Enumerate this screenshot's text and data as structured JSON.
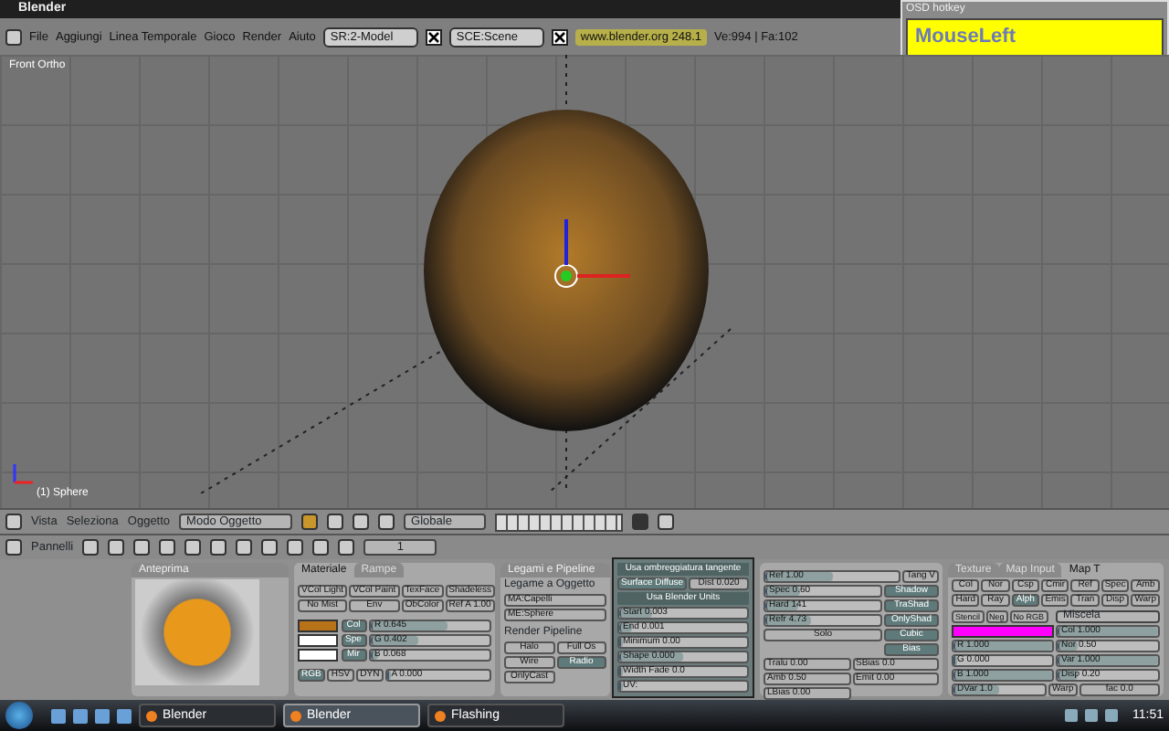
{
  "window": {
    "title": "Blender"
  },
  "menu": [
    "File",
    "Aggiungi",
    "Linea Temporale",
    "Gioco",
    "Render",
    "Aiuto"
  ],
  "screen_field": {
    "value": "SR:2-Model"
  },
  "scene_field": {
    "value": "SCE:Scene"
  },
  "version_link": "www.blender.org 248.1",
  "stats": "Ve:994 | Fa:102",
  "osd": {
    "title": "OSD hotkey",
    "text": "MouseLeft"
  },
  "viewport": {
    "view_label": "Front Ortho",
    "object_label": "(1) Sphere"
  },
  "view3d_header": {
    "menus": [
      "Vista",
      "Seleziona",
      "Oggetto"
    ],
    "mode": "Modo Oggetto",
    "orientation": "Globale"
  },
  "buttons_header": {
    "label": "Pannelli",
    "frame": "1"
  },
  "preview_panel": {
    "title": "Anteprima"
  },
  "material_panel": {
    "tabs": [
      {
        "label": "Materiale",
        "selected": true
      },
      {
        "label": "Rampe",
        "selected": false
      }
    ],
    "buttons": [
      {
        "label": "VCol Light",
        "on": false
      },
      {
        "label": "VCol Paint",
        "on": false
      },
      {
        "label": "TexFace",
        "on": false
      },
      {
        "label": "Shadeless",
        "on": false
      },
      {
        "label": "No Mist",
        "on": false
      },
      {
        "label": "Env",
        "on": false
      },
      {
        "label": "ObColor",
        "on": false
      },
      {
        "label": "Ref A 1.00",
        "on": false
      }
    ],
    "colors": [
      {
        "label": "Col",
        "color": "#b8731a",
        "reading": "R 0.645",
        "level": 0.645
      },
      {
        "label": "Spe",
        "color": "#ffffff",
        "reading": "G 0.402",
        "level": 0.402
      },
      {
        "label": "Mir",
        "color": "#ffffff",
        "reading": "B 0.068",
        "level": 0.068
      }
    ],
    "modes": [
      {
        "label": "RGB",
        "selected": true
      },
      {
        "label": "HSV",
        "selected": false
      },
      {
        "label": "DYN",
        "selected": false
      }
    ],
    "alpha": {
      "reading": "A 0.000",
      "level": 0.0
    }
  },
  "links_panel": {
    "title": "Legami e Pipeline",
    "link_label": "Legame a Oggetto",
    "material": "MA:Capelli",
    "mesh": "ME:Sphere",
    "pipeline_label": "Render Pipeline",
    "buttons": [
      {
        "label": "Halo",
        "on": false
      },
      {
        "label": "Full Os",
        "on": false
      },
      {
        "label": "Wire",
        "on": false
      },
      {
        "label": "Radio",
        "on": true
      },
      {
        "label": "OnlyCast",
        "on": false
      }
    ]
  },
  "shaders_panel": {
    "ref": {
      "label": "Ref 1.00",
      "level": 0.5
    },
    "tangent": "Tang V",
    "sliders": [
      {
        "label": "Spec 0.60",
        "level": 0.3
      },
      {
        "label": "Hard 141",
        "level": 0.28
      },
      {
        "label": "Refr 4.73",
        "level": 0.4
      }
    ],
    "toggles": [
      {
        "label": "Shadow",
        "on": true
      },
      {
        "label": "TraShad",
        "on": true
      },
      {
        "label": "OnlyShad",
        "on": true
      },
      {
        "label": "Cubic",
        "on": true
      },
      {
        "label": "Bias",
        "on": true
      }
    ],
    "solo": "Solo",
    "values": [
      "Tralu 0.00",
      "SBias 0.0",
      "Amb 0.50",
      "Emit 0.00",
      "LBias 0.00"
    ]
  },
  "popup": {
    "rows": [
      {
        "kind": "header",
        "label": "Usa ombreggiatura tangente"
      },
      {
        "kind": "pair",
        "label": "Surface Diffuse",
        "value": "Dist 0.020"
      },
      {
        "kind": "header",
        "label": "Usa Blender Units"
      },
      {
        "kind": "slider",
        "label": "Start 0.003",
        "level": 0.25
      },
      {
        "kind": "slider",
        "label": "End 0.001",
        "level": 0.1
      },
      {
        "kind": "slider",
        "label": "Minimum 0.00",
        "level": 0.0
      },
      {
        "kind": "slider",
        "label": "Shape 0.000",
        "level": 0.5
      },
      {
        "kind": "slider",
        "label": "Width Fade 0.0",
        "level": 0.0
      },
      {
        "kind": "slider",
        "label": "UV:",
        "level": 0.0
      }
    ]
  },
  "texture_panel": {
    "tabs": [
      {
        "label": "Texture",
        "selected": false
      },
      {
        "label": "Map Input",
        "selected": false
      },
      {
        "label": "Map T",
        "selected": true
      }
    ],
    "channels": [
      {
        "label": "Col",
        "on": false
      },
      {
        "label": "Nor",
        "on": false
      },
      {
        "label": "Csp",
        "on": false
      },
      {
        "label": "Cmir",
        "on": false
      },
      {
        "label": "Ref",
        "on": false
      },
      {
        "label": "Spec",
        "on": false
      },
      {
        "label": "Amb",
        "on": false
      },
      {
        "label": "Hard",
        "on": false
      },
      {
        "label": "Ray",
        "on": false
      },
      {
        "label": "Alph",
        "on": true
      },
      {
        "label": "Emis",
        "on": false
      },
      {
        "label": "Tran",
        "on": false
      },
      {
        "label": "Disp",
        "on": false
      },
      {
        "label": "Warp",
        "on": false
      }
    ],
    "flags": [
      "Stencil",
      "Neg",
      "No RGB"
    ],
    "blend": "Miscela",
    "swatch": {
      "color": "#ff00ff"
    },
    "rgb": [
      {
        "label": "R 1.000",
        "level": 1.0
      },
      {
        "label": "G 0.000",
        "level": 0.0
      },
      {
        "label": "B 1.000",
        "level": 1.0
      }
    ],
    "factors": [
      {
        "label": "Col 1.000",
        "level": 1.0
      },
      {
        "label": "Nor 0.50",
        "level": 0.2
      },
      {
        "label": "Var 1.000",
        "level": 1.0
      },
      {
        "label": "Disp 0.20",
        "level": 0.2
      }
    ],
    "dvar": {
      "label": "DVar 1.0",
      "level": 0.5
    },
    "warp": "Warp",
    "fac": "fac 0.0"
  },
  "taskbar": {
    "tasks": [
      {
        "label": "Blender",
        "selected": false
      },
      {
        "label": "Blender",
        "selected": true
      },
      {
        "label": "Flashing",
        "selected": false
      }
    ],
    "clock": "11:51"
  }
}
